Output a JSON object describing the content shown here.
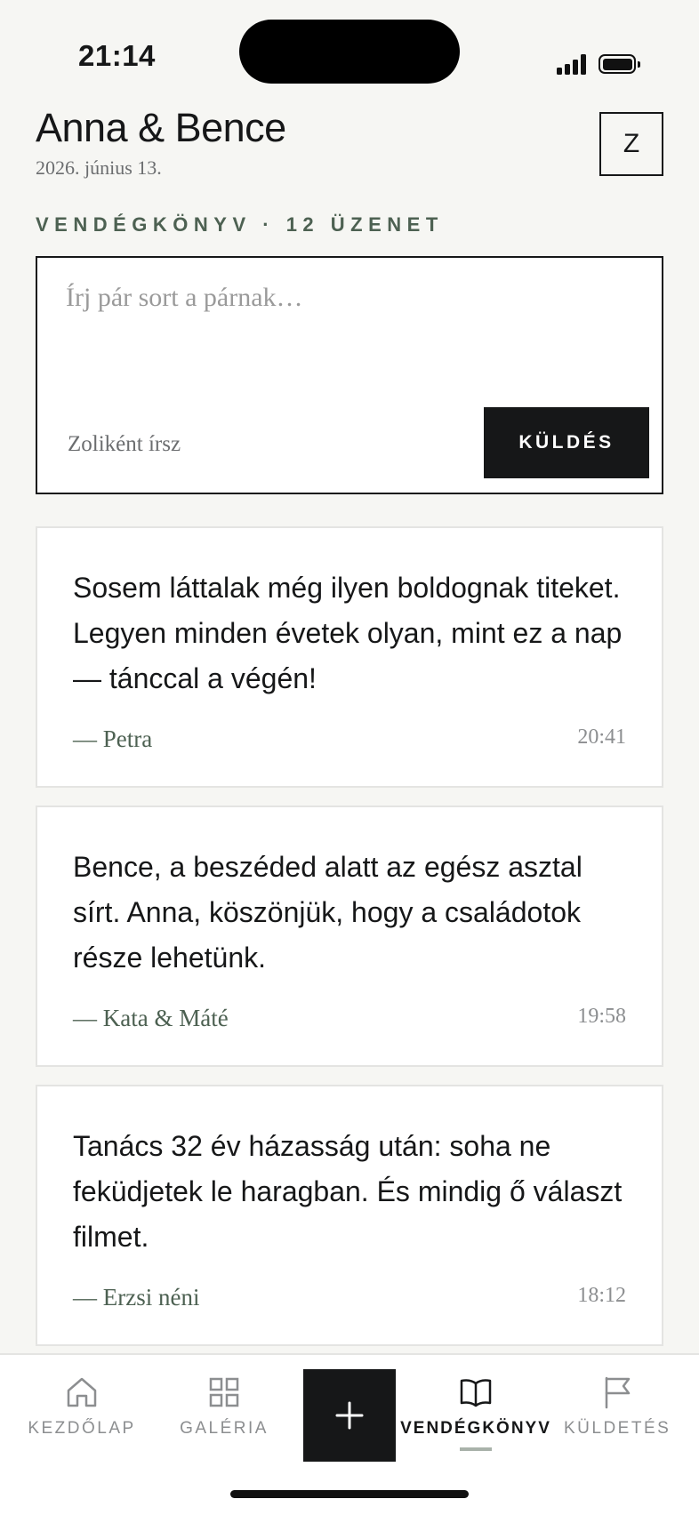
{
  "status_bar": {
    "time": "21:14"
  },
  "header": {
    "title": "Anna & Bence",
    "date": "2026. június 13.",
    "avatar_initial": "Z"
  },
  "section": {
    "label": "VENDÉGKÖNYV · 12 ÜZENET"
  },
  "composer": {
    "placeholder": "Írj pár sort a párnak…",
    "as_user": "Zoliként írsz",
    "send_label": "KÜLDÉS"
  },
  "messages": [
    {
      "text": "Sosem láttalak még ilyen boldognak titeket. Legyen minden évetek olyan, mint ez a nap — tánccal a végén!",
      "author": "— Petra",
      "time": "20:41"
    },
    {
      "text": "Bence, a beszéded alatt az egész asztal sírt. Anna, köszönjük, hogy a családotok része lehetünk.",
      "author": "— Kata & Máté",
      "time": "19:58"
    },
    {
      "text": "Tanács 32 év házasság után: soha ne feküdjetek le haragban. És mindig ő választ filmet.",
      "author": "— Erzsi néni",
      "time": "18:12"
    }
  ],
  "tabs": [
    {
      "label": "KEZDŐLAP",
      "icon": "home-icon"
    },
    {
      "label": "GALÉRIA",
      "icon": "grid-icon"
    },
    {
      "label": "VENDÉGKÖNYV",
      "icon": "book-icon",
      "active": true
    },
    {
      "label": "KÜLDETÉS",
      "icon": "flag-icon"
    }
  ],
  "colors": {
    "accent": "#4d6152",
    "ink": "#161718",
    "background": "#f6f6f3"
  }
}
